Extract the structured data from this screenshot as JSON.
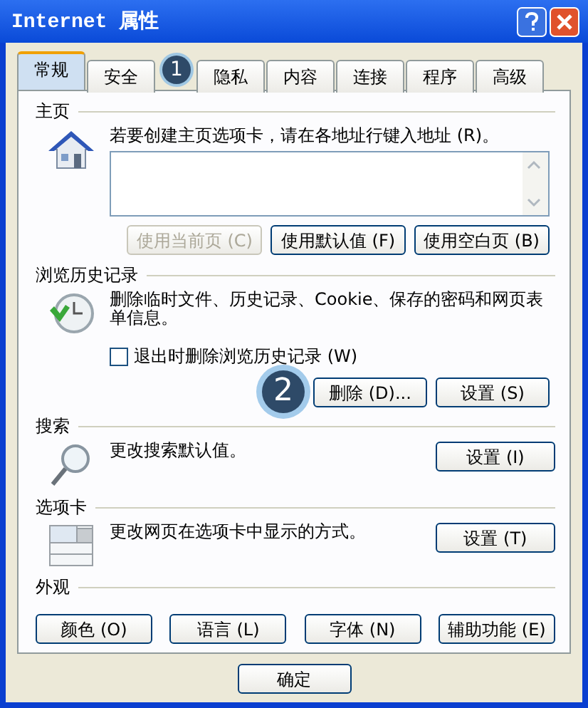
{
  "window": {
    "title": "Internet 属性"
  },
  "tabs": [
    {
      "label": "常规",
      "selected": true
    },
    {
      "label": "安全",
      "selected": false,
      "callout": "1"
    },
    {
      "label": "隐私",
      "selected": false
    },
    {
      "label": "内容",
      "selected": false
    },
    {
      "label": "连接",
      "selected": false
    },
    {
      "label": "程序",
      "selected": false
    },
    {
      "label": "高级",
      "selected": false
    }
  ],
  "sections": [
    {
      "kind": "home",
      "title": "主页",
      "description": "若要创建主页选项卡，请在各地址行键入地址 (R)。",
      "buttons": [
        {
          "label": "使用当前页 (C)",
          "disabled": true
        },
        {
          "label": "使用默认值 (F)",
          "disabled": false
        },
        {
          "label": "使用空白页 (B)",
          "disabled": false
        }
      ]
    },
    {
      "kind": "history",
      "title": "浏览历史记录",
      "description": "删除临时文件、历史记录、Cookie、保存的密码和网页表单信息。",
      "checkbox": {
        "label": "退出时删除浏览历史记录 (W)",
        "checked": false
      },
      "buttons": [
        {
          "label": "删除 (D)...",
          "disabled": false,
          "callout": "2"
        },
        {
          "label": "设置 (S)",
          "disabled": false
        }
      ]
    },
    {
      "kind": "search",
      "title": "搜索",
      "description": "更改搜索默认值。",
      "buttons": [
        {
          "label": "设置 (I)",
          "disabled": false
        }
      ]
    },
    {
      "kind": "tabbed",
      "title": "选项卡",
      "description": "更改网页在选项卡中显示的方式。",
      "buttons": [
        {
          "label": "设置 (T)",
          "disabled": false
        }
      ]
    },
    {
      "kind": "appearance",
      "title": "外观",
      "buttons": [
        {
          "label": "颜色 (O)",
          "disabled": false
        },
        {
          "label": "语言 (L)",
          "disabled": false
        },
        {
          "label": "字体 (N)",
          "disabled": false
        },
        {
          "label": "辅助功能 (E)",
          "disabled": false
        }
      ]
    }
  ],
  "footer_buttons": [
    {
      "label": "确定"
    }
  ]
}
